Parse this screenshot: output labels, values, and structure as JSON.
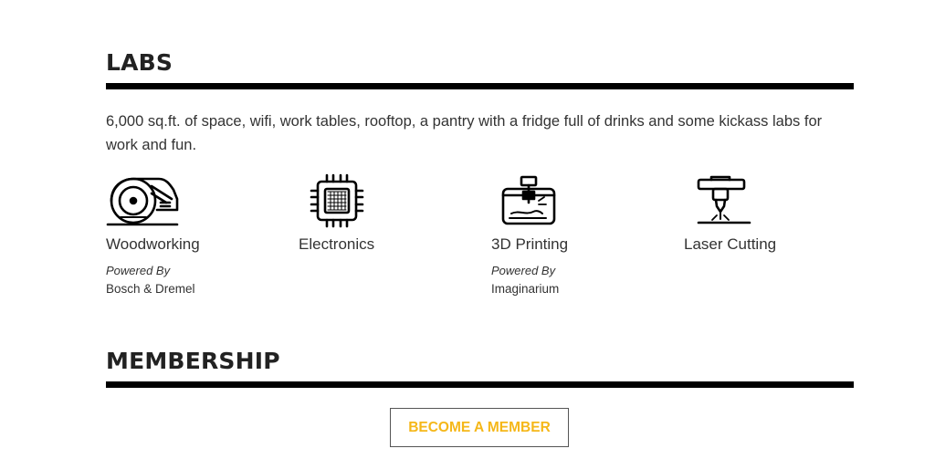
{
  "labs_section": {
    "title": "LABS",
    "intro": "6,000 sq.ft. of space, wifi, work tables, rooftop, a pantry with a fridge full of drinks and some kickass labs for work and fun.",
    "items": [
      {
        "name": "Woodworking",
        "icon": "circular-saw-icon",
        "powered_label": "Powered By",
        "sponsor": "Bosch & Dremel"
      },
      {
        "name": "Electronics",
        "icon": "microchip-icon"
      },
      {
        "name": "3D Printing",
        "icon": "3d-printer-icon",
        "powered_label": "Powered By",
        "sponsor": "Imaginarium"
      },
      {
        "name": "Laser Cutting",
        "icon": "laser-cutter-icon"
      }
    ]
  },
  "membership_section": {
    "title": "MEMBERSHIP",
    "cta_label": "BECOME A MEMBER"
  },
  "colors": {
    "accent": "#f5b719",
    "text": "#222222",
    "rule": "#000000"
  }
}
